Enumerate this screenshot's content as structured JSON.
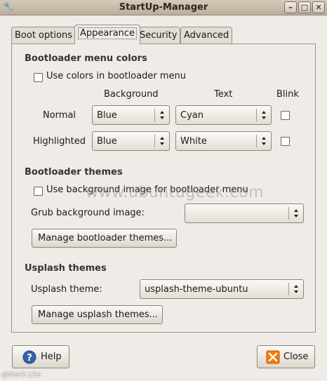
{
  "window": {
    "title": "StartUp-Manager"
  },
  "tabs": [
    {
      "label": "Boot options"
    },
    {
      "label": "Appearance"
    },
    {
      "label": "Security"
    },
    {
      "label": "Advanced"
    }
  ],
  "bootloader_colors": {
    "heading": "Bootloader menu colors",
    "use_colors_label": "Use colors in bootloader menu",
    "use_colors_checked": false,
    "col_headers": {
      "background": "Background",
      "text": "Text",
      "blink": "Blink"
    },
    "rows": [
      {
        "label": "Normal",
        "background": "Blue",
        "text": "Cyan",
        "blink": false
      },
      {
        "label": "Highlighted",
        "background": "Blue",
        "text": "White",
        "blink": false
      }
    ]
  },
  "bootloader_themes": {
    "heading": "Bootloader themes",
    "use_bg_image_label": "Use background image for bootloader menu",
    "use_bg_image_checked": false,
    "grub_bg_label": "Grub background image:",
    "grub_bg_value": "",
    "manage_button": "Manage bootloader themes..."
  },
  "usplash": {
    "heading": "Usplash themes",
    "theme_label": "Usplash theme:",
    "theme_value": "usplash-theme-ubuntu",
    "manage_button": "Manage usplash themes..."
  },
  "footer": {
    "help_button": "Help",
    "close_button": "Close"
  },
  "overlay": {
    "watermark": "www.ubuntugeek.com",
    "credit": "@Mark Lite"
  }
}
